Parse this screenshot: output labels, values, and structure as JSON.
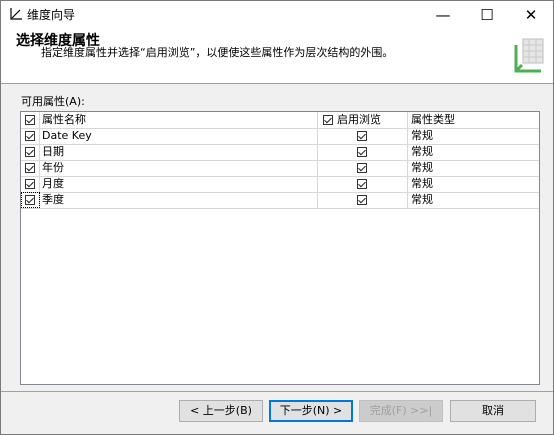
{
  "window": {
    "title": "维度向导",
    "minimize_glyph": "—",
    "maximize_glyph": "☐",
    "close_glyph": "✕"
  },
  "header": {
    "title": "选择维度属性",
    "description": "指定维度属性并选择“启用浏览”，以便使这些属性作为层次结构的外围。"
  },
  "section_label": "可用属性(A):",
  "grid": {
    "columns": {
      "name": "属性名称",
      "browse": "启用浏览",
      "type": "属性类型"
    },
    "header_checked": true,
    "header_browse_checked": true,
    "rows": [
      {
        "selected": true,
        "name": "Date Key",
        "browse": true,
        "type": "常规"
      },
      {
        "selected": true,
        "name": "日期",
        "browse": true,
        "type": "常规"
      },
      {
        "selected": true,
        "name": "年份",
        "browse": true,
        "type": "常规"
      },
      {
        "selected": true,
        "name": "月度",
        "browse": true,
        "type": "常规"
      },
      {
        "selected": true,
        "name": "季度",
        "browse": true,
        "type": "常规"
      }
    ]
  },
  "buttons": {
    "back": "< 上一步(B)",
    "next": "下一步(N) >",
    "finish": "完成(F) >>|",
    "cancel": "取消"
  },
  "colors": {
    "header_bg": "#ffffff",
    "body_bg": "#f0f0f0",
    "focus_border": "#0078d7",
    "graphic_green": "#4caf50"
  }
}
